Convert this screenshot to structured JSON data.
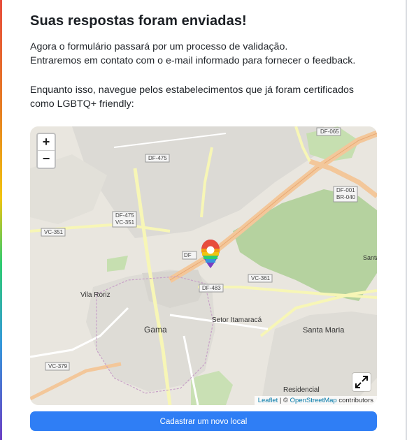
{
  "heading": "Suas respostas foram enviadas!",
  "message_lines": [
    "Agora o formulário passará por um processo de validação.",
    "Entraremos em contato com o e-mail informado para fornecer o feedback.",
    "Enquanto isso, navegue pelos estabelecimentos que já foram certificados",
    "como LGBTQ+ friendly:"
  ],
  "map": {
    "zoom_in": "+",
    "zoom_out": "−",
    "fullscreen_icon": "expand-icon",
    "marker_icon": "rainbow-pin-icon",
    "places": [
      "Vila Roriz",
      "Gama",
      "Setor Itamaracá",
      "Santa Maria",
      "Residencial",
      "Santa"
    ],
    "road_labels": [
      "DF-065",
      "DF-475",
      "DF-475",
      "VC-351",
      "VC-351",
      "DF-001",
      "BR-040",
      "DF-483",
      "VC-361",
      "VC-379",
      "DF"
    ],
    "attribution": {
      "leaflet": "Leaflet",
      "sep": " | © ",
      "osm": "OpenStreetMap",
      "contrib": " contributors"
    },
    "colors": {
      "land": "#e9e6df",
      "urban": "#dcdad5",
      "forest": "#b5d29f",
      "major_road": "#f3c79a",
      "secondary_road": "#f7f6b6"
    }
  },
  "cta_label": "Cadastrar um novo local",
  "colors": {
    "button": "#2f7ef5",
    "text": "#1f2328"
  }
}
